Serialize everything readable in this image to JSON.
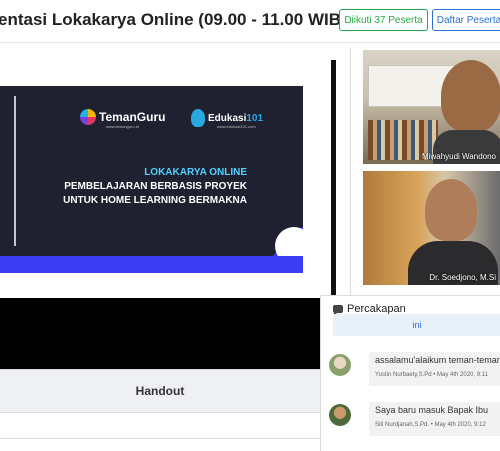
{
  "header": {
    "title": "entasi Lokakarya Online (09.00 - 11.00 WIB)",
    "attendance_button": "Diikuti 37 Peserta",
    "participants_button": "Daftar Peserta"
  },
  "slide": {
    "logo1_name_a": "Teman",
    "logo1_name_b": "Guru",
    "logo1_url": "www.temanguru.id",
    "logo2_name_a": "Edukasi",
    "logo2_name_b": "101",
    "logo2_url": "www.edukasi101.com",
    "line1": "LOKAKARYA ONLINE",
    "line2": "PEMBELAJARAN BERBASIS PROYEK",
    "line3": "UNTUK HOME LEARNING BERMAKNA"
  },
  "handout_label": "Handout",
  "cams": [
    {
      "name": "Miwahyudi Wandono"
    },
    {
      "name": "Dr. Soedjono, M.Si"
    }
  ],
  "chat": {
    "title": "Percakapan",
    "info_text": "ini",
    "messages": [
      {
        "text": "assalamu'alaikum teman-teman",
        "meta": "Yustin Nurbaety,S.Pd • May 4th 2020, 9:11"
      },
      {
        "text": "Saya baru masuk Bapak Ibu",
        "meta": "Siti Nurdjanah,S.Pd. • May 4th 2020, 9:12"
      }
    ]
  },
  "colors": {
    "accent_green": "#27a844",
    "accent_blue": "#2f6fd0",
    "slide_blue": "#3c3df2"
  }
}
